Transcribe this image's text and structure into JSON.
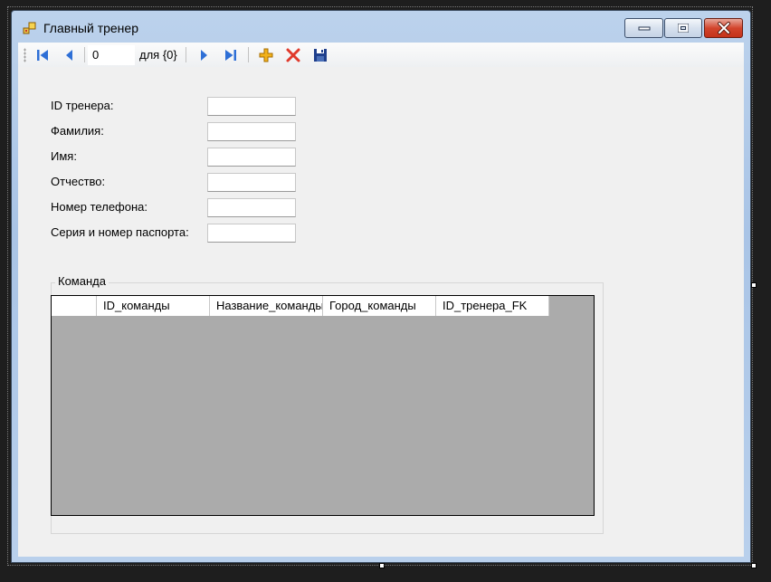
{
  "window": {
    "title": "Главный тренер"
  },
  "navigator": {
    "position": "0",
    "count_label": "для {0}"
  },
  "form": {
    "fields": [
      {
        "label": "ID тренера:"
      },
      {
        "label": "Фамилия:"
      },
      {
        "label": "Имя:"
      },
      {
        "label": "Отчество:"
      },
      {
        "label": "Номер телефона:"
      },
      {
        "label": "Серия и номер паспорта:"
      }
    ]
  },
  "team_group": {
    "label": "Команда",
    "columns": [
      "ID_команды",
      "Название_команды",
      "Город_команды",
      "ID_тренера_FK"
    ]
  },
  "colors": {
    "nav_blue": "#2e6fd6",
    "add_yellow": "#f2b21b",
    "delete_red": "#e03a2c",
    "save_navy": "#1f3f8c",
    "grid_background": "#ababab"
  },
  "icons": [
    "app-icon",
    "move-first-icon",
    "move-previous-icon",
    "move-next-icon",
    "move-last-icon",
    "add-new-icon",
    "delete-icon",
    "save-icon",
    "minimize-icon",
    "maximize-icon",
    "close-icon"
  ]
}
